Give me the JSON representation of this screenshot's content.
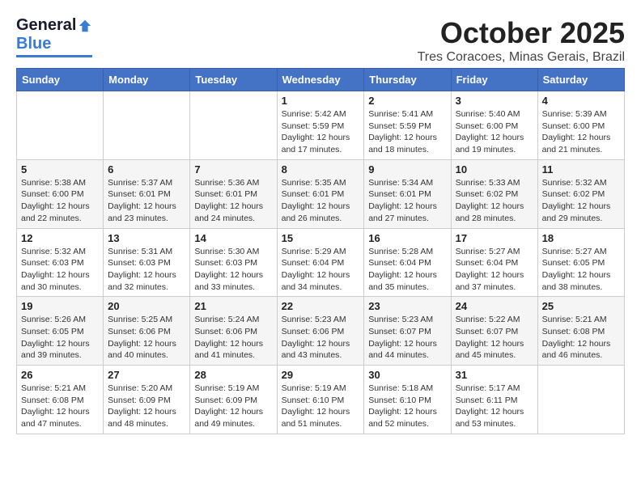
{
  "logo": {
    "general": "General",
    "blue": "Blue"
  },
  "title": "October 2025",
  "location": "Tres Coracoes, Minas Gerais, Brazil",
  "headers": [
    "Sunday",
    "Monday",
    "Tuesday",
    "Wednesday",
    "Thursday",
    "Friday",
    "Saturday"
  ],
  "weeks": [
    [
      {
        "day": "",
        "info": ""
      },
      {
        "day": "",
        "info": ""
      },
      {
        "day": "",
        "info": ""
      },
      {
        "day": "1",
        "info": "Sunrise: 5:42 AM\nSunset: 5:59 PM\nDaylight: 12 hours\nand 17 minutes."
      },
      {
        "day": "2",
        "info": "Sunrise: 5:41 AM\nSunset: 5:59 PM\nDaylight: 12 hours\nand 18 minutes."
      },
      {
        "day": "3",
        "info": "Sunrise: 5:40 AM\nSunset: 6:00 PM\nDaylight: 12 hours\nand 19 minutes."
      },
      {
        "day": "4",
        "info": "Sunrise: 5:39 AM\nSunset: 6:00 PM\nDaylight: 12 hours\nand 21 minutes."
      }
    ],
    [
      {
        "day": "5",
        "info": "Sunrise: 5:38 AM\nSunset: 6:00 PM\nDaylight: 12 hours\nand 22 minutes."
      },
      {
        "day": "6",
        "info": "Sunrise: 5:37 AM\nSunset: 6:01 PM\nDaylight: 12 hours\nand 23 minutes."
      },
      {
        "day": "7",
        "info": "Sunrise: 5:36 AM\nSunset: 6:01 PM\nDaylight: 12 hours\nand 24 minutes."
      },
      {
        "day": "8",
        "info": "Sunrise: 5:35 AM\nSunset: 6:01 PM\nDaylight: 12 hours\nand 26 minutes."
      },
      {
        "day": "9",
        "info": "Sunrise: 5:34 AM\nSunset: 6:01 PM\nDaylight: 12 hours\nand 27 minutes."
      },
      {
        "day": "10",
        "info": "Sunrise: 5:33 AM\nSunset: 6:02 PM\nDaylight: 12 hours\nand 28 minutes."
      },
      {
        "day": "11",
        "info": "Sunrise: 5:32 AM\nSunset: 6:02 PM\nDaylight: 12 hours\nand 29 minutes."
      }
    ],
    [
      {
        "day": "12",
        "info": "Sunrise: 5:32 AM\nSunset: 6:03 PM\nDaylight: 12 hours\nand 30 minutes."
      },
      {
        "day": "13",
        "info": "Sunrise: 5:31 AM\nSunset: 6:03 PM\nDaylight: 12 hours\nand 32 minutes."
      },
      {
        "day": "14",
        "info": "Sunrise: 5:30 AM\nSunset: 6:03 PM\nDaylight: 12 hours\nand 33 minutes."
      },
      {
        "day": "15",
        "info": "Sunrise: 5:29 AM\nSunset: 6:04 PM\nDaylight: 12 hours\nand 34 minutes."
      },
      {
        "day": "16",
        "info": "Sunrise: 5:28 AM\nSunset: 6:04 PM\nDaylight: 12 hours\nand 35 minutes."
      },
      {
        "day": "17",
        "info": "Sunrise: 5:27 AM\nSunset: 6:04 PM\nDaylight: 12 hours\nand 37 minutes."
      },
      {
        "day": "18",
        "info": "Sunrise: 5:27 AM\nSunset: 6:05 PM\nDaylight: 12 hours\nand 38 minutes."
      }
    ],
    [
      {
        "day": "19",
        "info": "Sunrise: 5:26 AM\nSunset: 6:05 PM\nDaylight: 12 hours\nand 39 minutes."
      },
      {
        "day": "20",
        "info": "Sunrise: 5:25 AM\nSunset: 6:06 PM\nDaylight: 12 hours\nand 40 minutes."
      },
      {
        "day": "21",
        "info": "Sunrise: 5:24 AM\nSunset: 6:06 PM\nDaylight: 12 hours\nand 41 minutes."
      },
      {
        "day": "22",
        "info": "Sunrise: 5:23 AM\nSunset: 6:06 PM\nDaylight: 12 hours\nand 43 minutes."
      },
      {
        "day": "23",
        "info": "Sunrise: 5:23 AM\nSunset: 6:07 PM\nDaylight: 12 hours\nand 44 minutes."
      },
      {
        "day": "24",
        "info": "Sunrise: 5:22 AM\nSunset: 6:07 PM\nDaylight: 12 hours\nand 45 minutes."
      },
      {
        "day": "25",
        "info": "Sunrise: 5:21 AM\nSunset: 6:08 PM\nDaylight: 12 hours\nand 46 minutes."
      }
    ],
    [
      {
        "day": "26",
        "info": "Sunrise: 5:21 AM\nSunset: 6:08 PM\nDaylight: 12 hours\nand 47 minutes."
      },
      {
        "day": "27",
        "info": "Sunrise: 5:20 AM\nSunset: 6:09 PM\nDaylight: 12 hours\nand 48 minutes."
      },
      {
        "day": "28",
        "info": "Sunrise: 5:19 AM\nSunset: 6:09 PM\nDaylight: 12 hours\nand 49 minutes."
      },
      {
        "day": "29",
        "info": "Sunrise: 5:19 AM\nSunset: 6:10 PM\nDaylight: 12 hours\nand 51 minutes."
      },
      {
        "day": "30",
        "info": "Sunrise: 5:18 AM\nSunset: 6:10 PM\nDaylight: 12 hours\nand 52 minutes."
      },
      {
        "day": "31",
        "info": "Sunrise: 5:17 AM\nSunset: 6:11 PM\nDaylight: 12 hours\nand 53 minutes."
      },
      {
        "day": "",
        "info": ""
      }
    ]
  ]
}
